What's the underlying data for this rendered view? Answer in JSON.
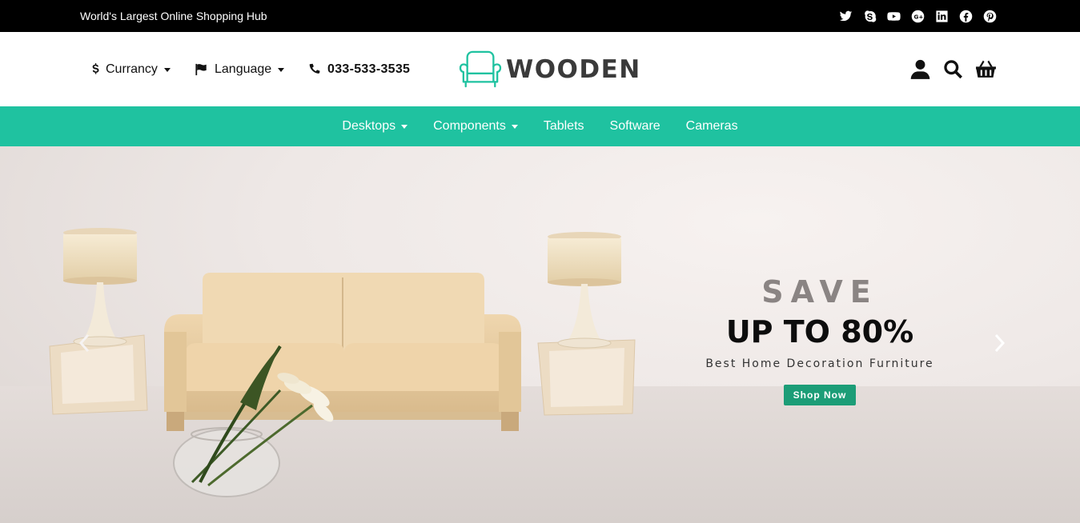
{
  "topbar": {
    "tagline": "World's Largest Online Shopping Hub",
    "social": [
      "twitter-icon",
      "skype-icon",
      "youtube-icon",
      "google-plus-icon",
      "linkedin-icon",
      "facebook-icon",
      "pinterest-icon"
    ]
  },
  "header": {
    "currency_label": "Currancy",
    "language_label": "Language",
    "phone": "033-533-3535",
    "logo_text": "WOODEN",
    "brand_color": "#1fc2a0"
  },
  "nav": {
    "items": [
      {
        "label": "Desktops",
        "dropdown": true
      },
      {
        "label": "Components",
        "dropdown": true
      },
      {
        "label": "Tablets",
        "dropdown": false
      },
      {
        "label": "Software",
        "dropdown": false
      },
      {
        "label": "Cameras",
        "dropdown": false
      }
    ]
  },
  "hero": {
    "save": "SAVE",
    "headline": "UP TO 80%",
    "subtitle": "Best Home Decoration Furniture",
    "cta": "Shop Now",
    "cta_color": "#1c9d77"
  }
}
